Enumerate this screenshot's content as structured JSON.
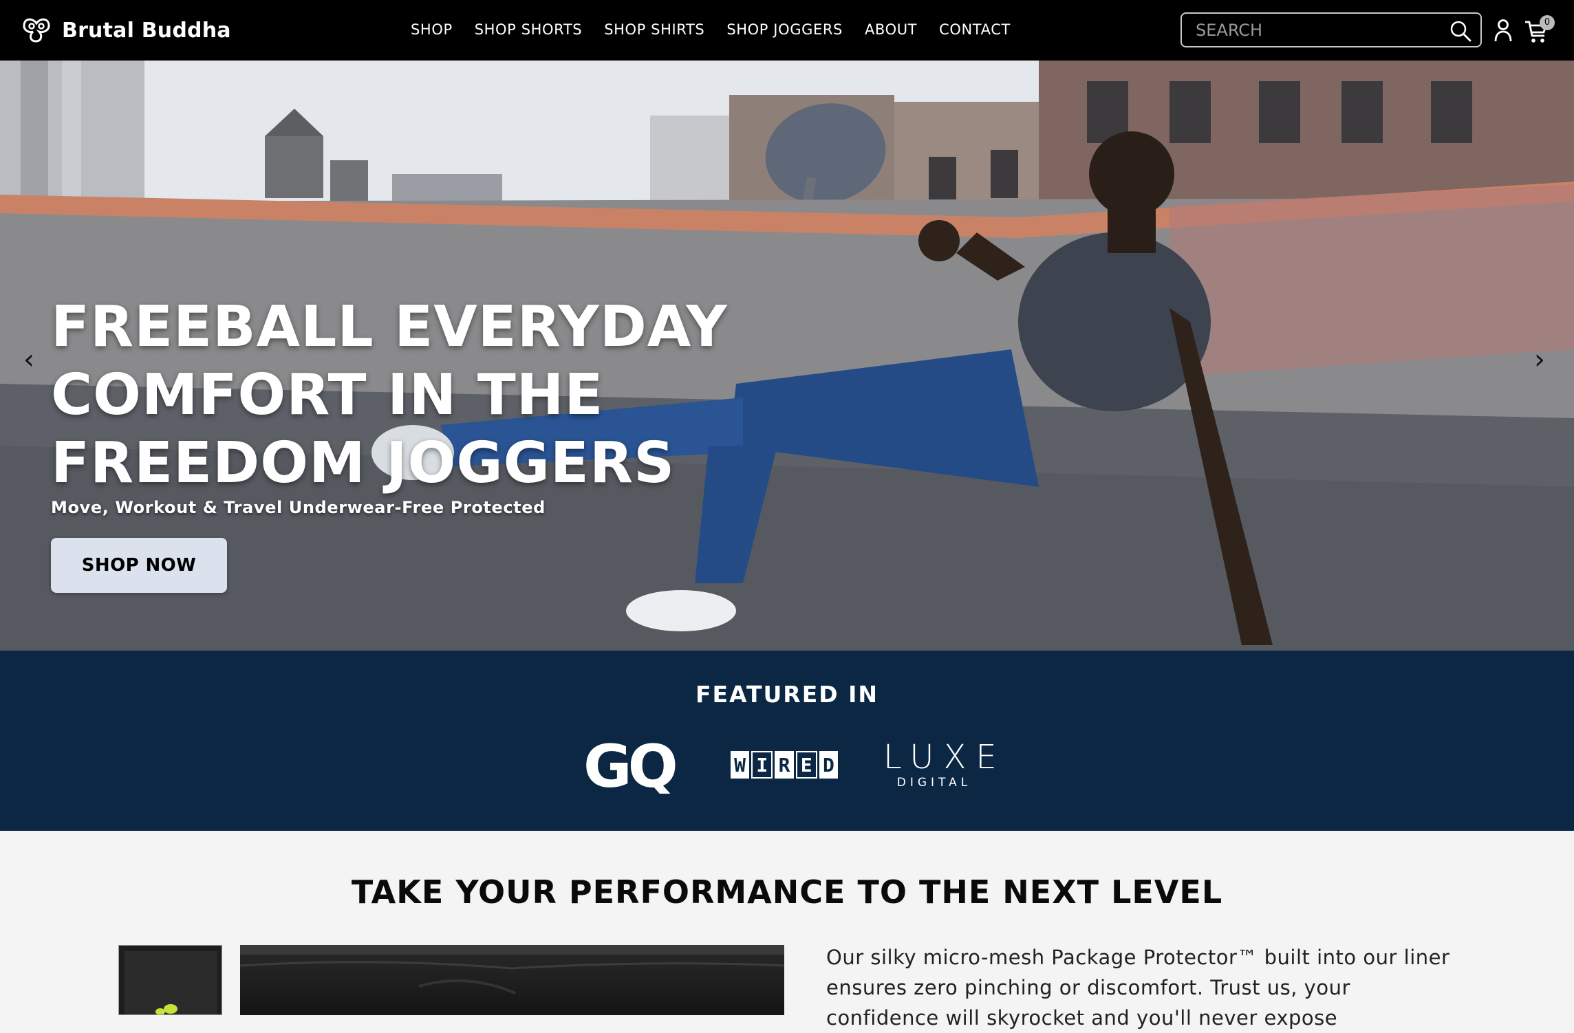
{
  "header": {
    "brand": "Brutal Buddha",
    "nav": [
      "SHOP",
      "SHOP SHORTS",
      "SHOP SHIRTS",
      "SHOP JOGGERS",
      "ABOUT",
      "CONTACT"
    ],
    "search_placeholder": "SEARCH",
    "cart_count": "0",
    "icons": [
      "brand-logo-icon",
      "search-icon",
      "account-icon",
      "cart-icon"
    ]
  },
  "hero": {
    "heading_lines": [
      "FREEBALL EVERYDAY",
      "COMFORT IN THE",
      "FREEDOM JOGGERS"
    ],
    "subheading": "Move, Workout & Travel Underwear-Free Protected",
    "cta_label": "SHOP NOW",
    "prev_arrow": "‹",
    "next_arrow": "›"
  },
  "featured": {
    "title": "FEATURED IN",
    "logos": {
      "gq": "GQ",
      "wired": [
        "W",
        "I",
        "R",
        "E",
        "D"
      ],
      "luxe": "LUXE",
      "luxe_sub": "DIGITAL"
    }
  },
  "performance": {
    "title": "TAKE YOUR PERFORMANCE TO THE NEXT LEVEL",
    "body": "Our silky micro-mesh Package Protector™ built into our liner ensures zero pinching or discomfort. Trust us, your confidence will skyrocket and you'll never expose"
  },
  "colors": {
    "header_bg": "#000000",
    "featured_bg": "#0c2744",
    "cta_bg": "#dbe2ee",
    "page_bg": "#f4f4f4"
  }
}
